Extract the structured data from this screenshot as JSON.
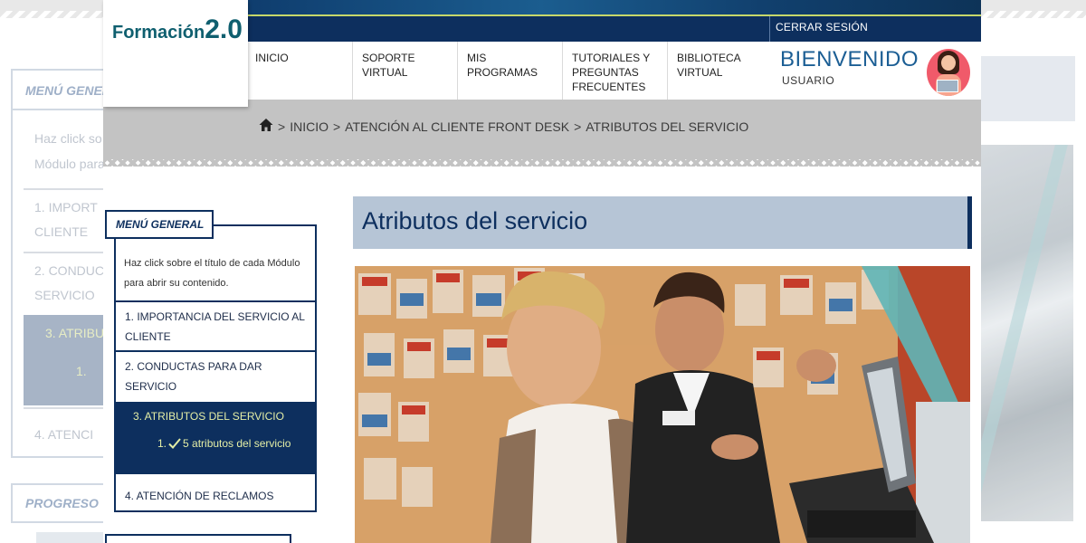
{
  "brand": {
    "logo_word": "Formación",
    "logo_version": "2.0"
  },
  "header": {
    "logout_label": "CERRAR SESIÓN"
  },
  "nav": {
    "items": [
      {
        "label": "INICIO"
      },
      {
        "label": "SOPORTE VIRTUAL"
      },
      {
        "label": "MIS PROGRAMAS"
      },
      {
        "label": "TUTORIALES Y PREGUNTAS FRECUENTES"
      },
      {
        "label": "BIBLIOTECA VIRTUAL"
      }
    ]
  },
  "user": {
    "welcome": "BIENVENIDO",
    "name": "USUARIO"
  },
  "breadcrumb": {
    "items": [
      "INICIO",
      "ATENCIÓN AL CLIENTE FRONT DESK",
      "ATRIBUTOS DEL SERVICIO"
    ],
    "separator": ">"
  },
  "menu": {
    "title": "MENÚ GENERAL",
    "help": "Haz click sobre el título de cada Módulo para abrir su contenido.",
    "modules": [
      {
        "label": "1. IMPORTANCIA DEL SERVICIO AL CLIENTE"
      },
      {
        "label": "2. CONDUCTAS PARA DAR SERVICIO"
      },
      {
        "label": "3. ATRIBUTOS DEL SERVICIO"
      },
      {
        "label": "4. ATENCIÓN DE RECLAMOS"
      }
    ],
    "active_sub": {
      "number": "1.",
      "label": "5 atributos del servicio"
    }
  },
  "ghost": {
    "menu_title": "MENÚ GENERAL",
    "help_line1": "Haz click so",
    "help_line2": "Módulo para",
    "item1_line1": "1. IMPORT",
    "item1_line2": "CLIENTE",
    "item2_line1": "2. CONDUC",
    "item2_line2": "SERVICIO",
    "item3": "3. ATRIBU",
    "item3_sub": "1.",
    "item4": "4. ATENCI",
    "progress": "PROGRESO"
  },
  "content": {
    "title": "Atributos del servicio"
  },
  "colors": {
    "navy": "#0d2f5e",
    "accent_lime": "#e4eea6",
    "title_bar": "#b6c5d6"
  }
}
